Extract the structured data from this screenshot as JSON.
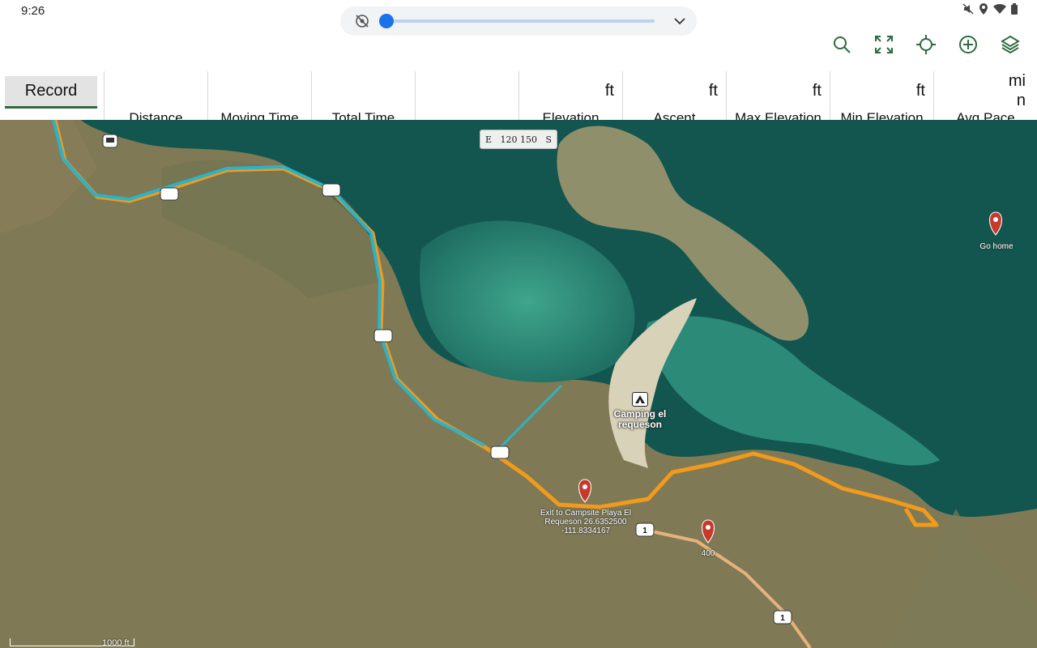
{
  "status_bar": {
    "time": "9:26"
  },
  "toolbar": {
    "buttons": [
      "search-icon",
      "fullscreen-icon",
      "locate-icon",
      "add-icon",
      "layers-icon"
    ]
  },
  "media_control": {
    "progress": 0
  },
  "stats": {
    "record_label": "Record",
    "cells": [
      {
        "label": "Distance",
        "unit": ""
      },
      {
        "label": "Moving Time",
        "unit": ""
      },
      {
        "label": "Total Time",
        "unit": ""
      },
      {
        "label": "",
        "unit": ""
      },
      {
        "label": "Elevation",
        "unit": "ft"
      },
      {
        "label": "Ascent",
        "unit": "ft"
      },
      {
        "label": "Max Elevation",
        "unit": "ft"
      },
      {
        "label": "Min Elevation",
        "unit": "ft"
      },
      {
        "label": "Avg Pace",
        "unit": "mi\nn"
      }
    ]
  },
  "map": {
    "compass": {
      "left": "E",
      "ticks": "120 150",
      "right": "S"
    },
    "camp_label": "Camping el requeson",
    "waypoints": {
      "exit": "Exit to Campsite Playa El Requeson 26.6352500 -111.8334167",
      "km400": "400",
      "home": "Go home"
    },
    "road_shields": [
      "1",
      "1"
    ],
    "scale": "1000 ft",
    "colors": {
      "water": "#1f7a72",
      "land": "#7d7a55",
      "track_orange": "#f29a1c",
      "track_blue": "#2bb3c9",
      "road": "#e7b27a",
      "pin": "#c63a2b"
    }
  }
}
